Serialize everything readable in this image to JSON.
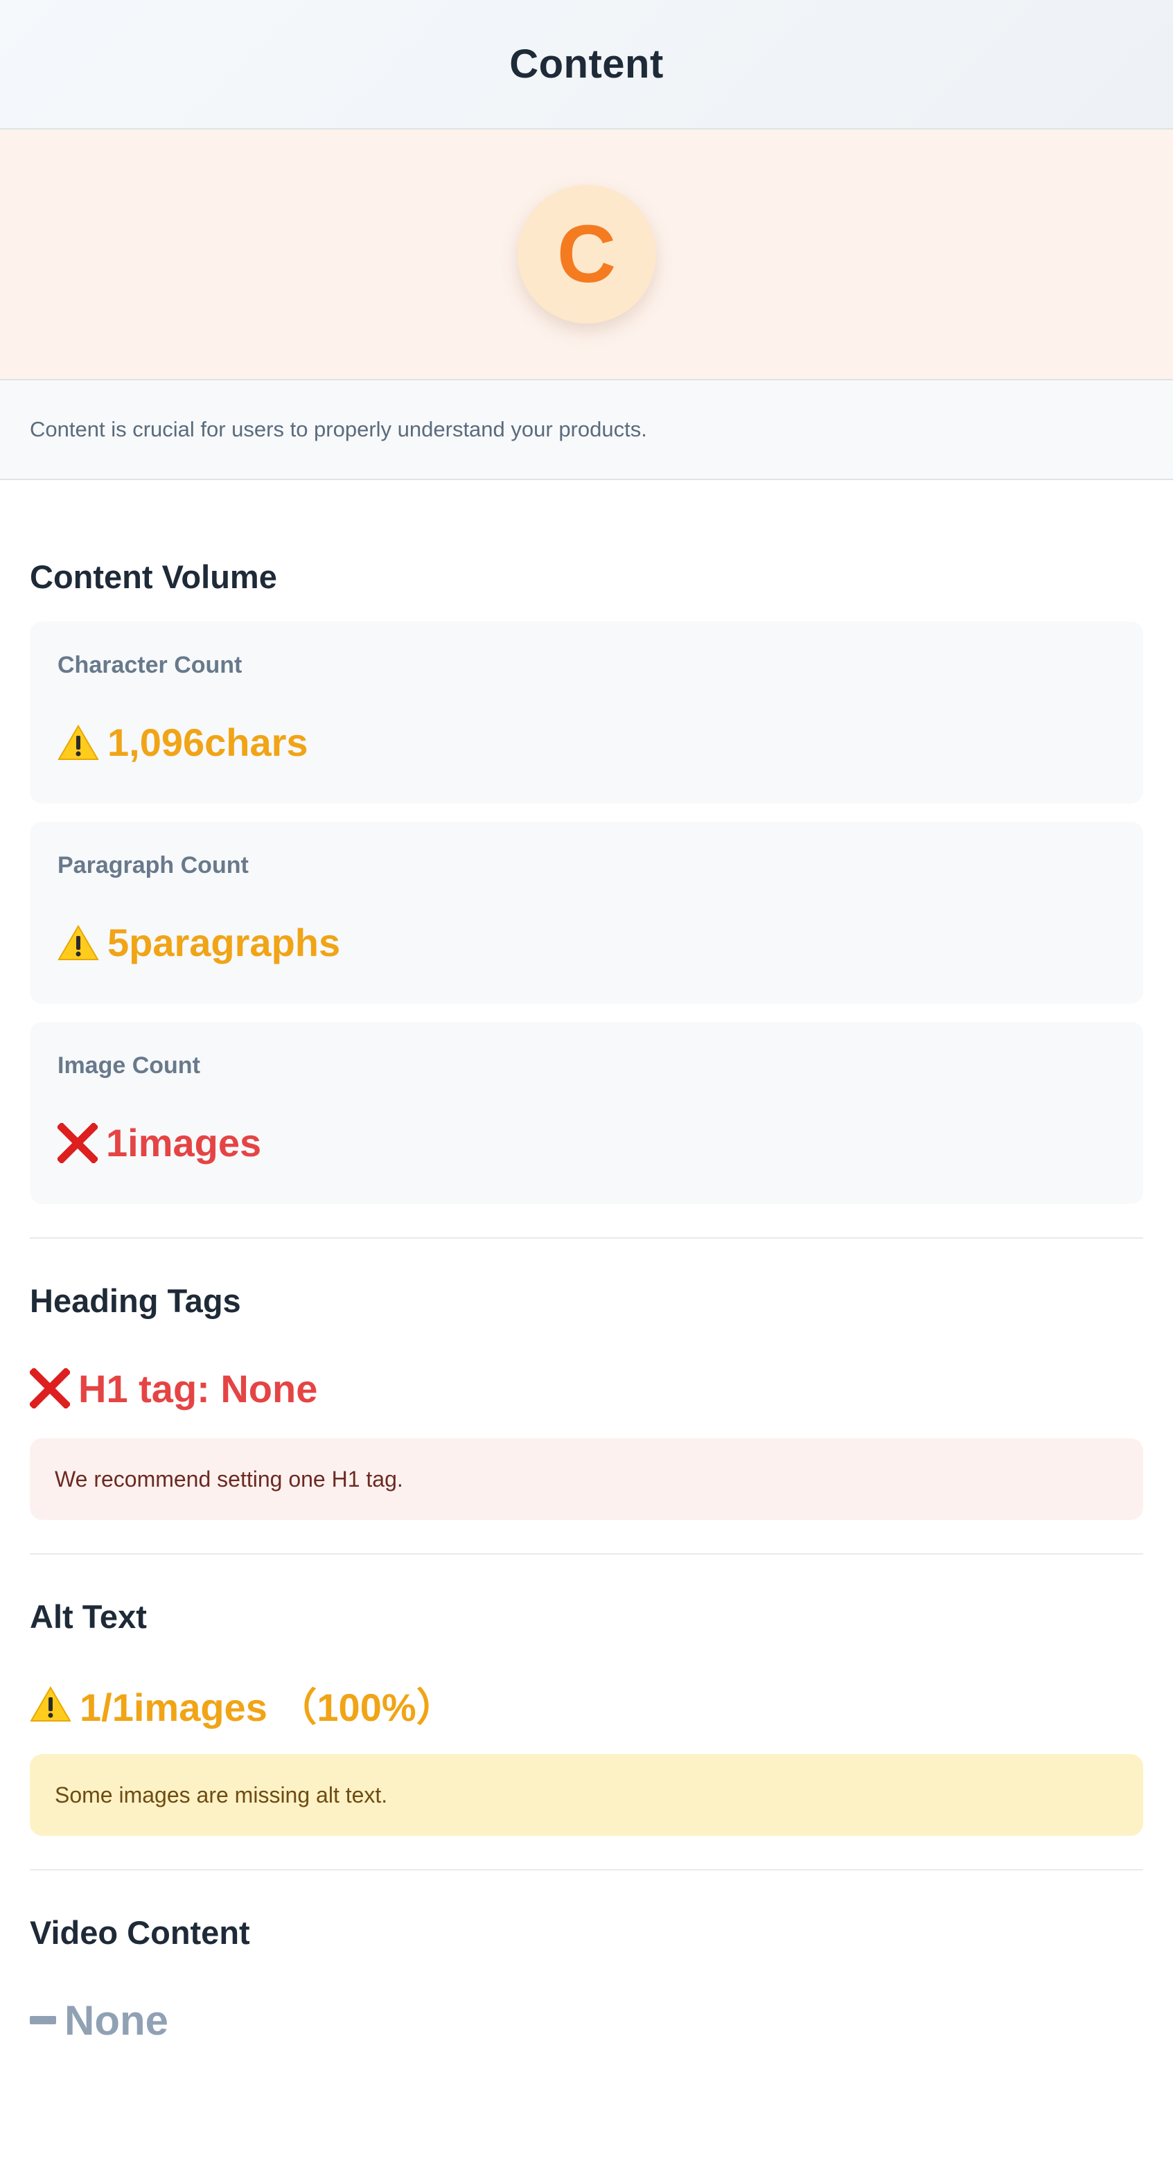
{
  "header": {
    "title": "Content"
  },
  "hero": {
    "avatar_letter": "C"
  },
  "description": "Content is crucial for users to properly understand your products.",
  "content_volume": {
    "title": "Content Volume",
    "cards": [
      {
        "label": "Character Count",
        "value": "1,096chars",
        "status": "warning",
        "icon": "warning-icon"
      },
      {
        "label": "Paragraph Count",
        "value": "5paragraphs",
        "status": "warning",
        "icon": "warning-icon"
      },
      {
        "label": "Image Count",
        "value": "1images",
        "status": "error",
        "icon": "cross-icon"
      }
    ]
  },
  "heading_tags": {
    "title": "Heading Tags",
    "status_text": "H1 tag: None",
    "status": "error",
    "note": "We recommend setting one H1 tag."
  },
  "alt_text": {
    "title": "Alt Text",
    "status_text": "1/1images （100%）",
    "status": "warning",
    "note": "Some images are missing alt text."
  },
  "video_content": {
    "title": "Video Content",
    "status_text": "None",
    "status": "none"
  },
  "colors": {
    "warning": "#f0a416",
    "error": "#e54444",
    "muted": "#91a1b4",
    "accent": "#f47b20"
  }
}
